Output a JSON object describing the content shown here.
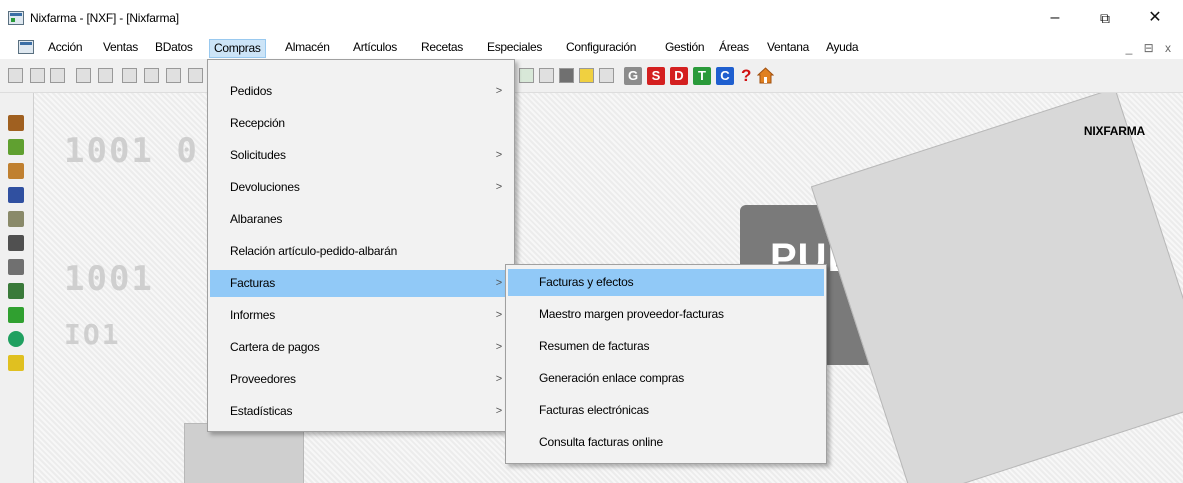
{
  "window": {
    "title": "Nixfarma - [NXF] - [Nixfarma]",
    "minimize": "–",
    "restore": "⧉",
    "close": "✕"
  },
  "menubar": {
    "items": [
      {
        "label": "Acción"
      },
      {
        "label": "Ventas"
      },
      {
        "label": "BDatos"
      },
      {
        "label": "Compras",
        "active": true
      },
      {
        "label": "Almacén"
      },
      {
        "label": "Artículos"
      },
      {
        "label": "Recetas"
      },
      {
        "label": "Especiales"
      },
      {
        "label": "Configuración"
      },
      {
        "label": "Gestión"
      },
      {
        "label": "Áreas"
      },
      {
        "label": "Ventana"
      },
      {
        "label": "Ayuda"
      }
    ],
    "mdi_controls": "_ ⊟ x"
  },
  "toolbar": {
    "letter_buttons": [
      {
        "label": "G",
        "color": "#8c8c8c"
      },
      {
        "label": "S",
        "color": "#d42020"
      },
      {
        "label": "D",
        "color": "#d42020"
      },
      {
        "label": "T",
        "color": "#2a9a3a"
      },
      {
        "label": "C",
        "color": "#1f5fcf"
      }
    ],
    "help_label": "?"
  },
  "brand": {
    "label": "NIXFARMA",
    "watermark": "PULSO"
  },
  "compras_menu": {
    "items": [
      {
        "label": "Pedidos",
        "submenu": true
      },
      {
        "label": "Recepción",
        "submenu": false
      },
      {
        "label": "Solicitudes",
        "submenu": true
      },
      {
        "label": "Devoluciones",
        "submenu": true
      },
      {
        "label": "Albaranes",
        "submenu": false
      },
      {
        "label": "Relación artículo-pedido-albarán",
        "submenu": false
      },
      {
        "label": "Facturas",
        "submenu": true,
        "highlighted": true
      },
      {
        "label": "Informes",
        "submenu": true
      },
      {
        "label": "Cartera de pagos",
        "submenu": true
      },
      {
        "label": "Proveedores",
        "submenu": true
      },
      {
        "label": "Estadísticas",
        "submenu": true
      }
    ],
    "arrow": ">"
  },
  "facturas_menu": {
    "items": [
      {
        "label": "Facturas y efectos",
        "highlighted": true
      },
      {
        "label": "Maestro margen proveedor-facturas"
      },
      {
        "label": "Resumen de facturas"
      },
      {
        "label": "Generación enlace compras"
      },
      {
        "label": "Facturas electrónicas"
      },
      {
        "label": "Consulta facturas online"
      }
    ]
  },
  "colors": {
    "menu_highlight": "#91c9f7",
    "menubar_active": "#cce4f7"
  }
}
